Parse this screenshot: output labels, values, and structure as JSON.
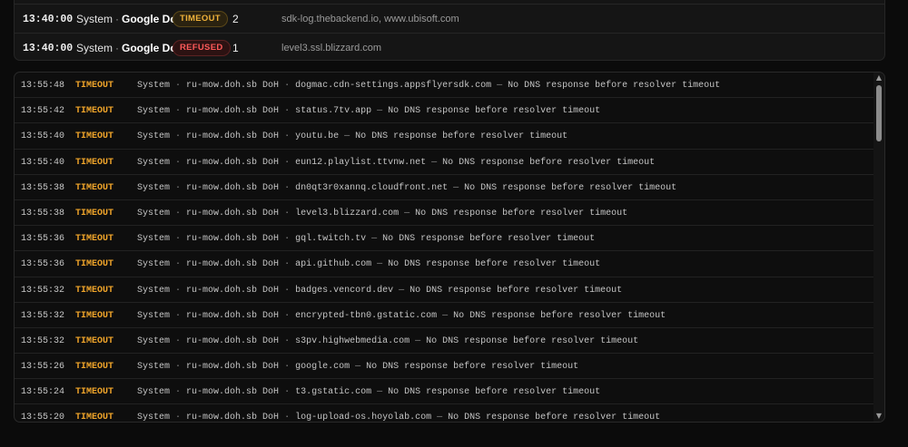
{
  "summary": {
    "rows": [
      {
        "time": "13:40:00",
        "system": "System",
        "resolver": "Google DoH",
        "status": "TIMEOUT",
        "count": "2",
        "domains": "sdk-log.thebackend.io, www.ubisoft.com"
      },
      {
        "time": "13:40:00",
        "system": "System",
        "resolver": "Google DoH",
        "status": "REFUSED",
        "count": "1",
        "domains": "level3.ssl.blizzard.com"
      }
    ]
  },
  "log": {
    "entries": [
      {
        "time": "13:55:48",
        "status": "TIMEOUT",
        "system": "System",
        "resolver": "ru-mow.doh.sb DoH",
        "domain": "dogmac.cdn-settings.appsflyersdk.com",
        "message": "No DNS response before resolver timeout"
      },
      {
        "time": "13:55:42",
        "status": "TIMEOUT",
        "system": "System",
        "resolver": "ru-mow.doh.sb DoH",
        "domain": "status.7tv.app",
        "message": "No DNS response before resolver timeout"
      },
      {
        "time": "13:55:40",
        "status": "TIMEOUT",
        "system": "System",
        "resolver": "ru-mow.doh.sb DoH",
        "domain": "youtu.be",
        "message": "No DNS response before resolver timeout"
      },
      {
        "time": "13:55:40",
        "status": "TIMEOUT",
        "system": "System",
        "resolver": "ru-mow.doh.sb DoH",
        "domain": "eun12.playlist.ttvnw.net",
        "message": "No DNS response before resolver timeout"
      },
      {
        "time": "13:55:38",
        "status": "TIMEOUT",
        "system": "System",
        "resolver": "ru-mow.doh.sb DoH",
        "domain": "dn0qt3r0xannq.cloudfront.net",
        "message": "No DNS response before resolver timeout"
      },
      {
        "time": "13:55:38",
        "status": "TIMEOUT",
        "system": "System",
        "resolver": "ru-mow.doh.sb DoH",
        "domain": "level3.blizzard.com",
        "message": "No DNS response before resolver timeout"
      },
      {
        "time": "13:55:36",
        "status": "TIMEOUT",
        "system": "System",
        "resolver": "ru-mow.doh.sb DoH",
        "domain": "gql.twitch.tv",
        "message": "No DNS response before resolver timeout"
      },
      {
        "time": "13:55:36",
        "status": "TIMEOUT",
        "system": "System",
        "resolver": "ru-mow.doh.sb DoH",
        "domain": "api.github.com",
        "message": "No DNS response before resolver timeout"
      },
      {
        "time": "13:55:32",
        "status": "TIMEOUT",
        "system": "System",
        "resolver": "ru-mow.doh.sb DoH",
        "domain": "badges.vencord.dev",
        "message": "No DNS response before resolver timeout"
      },
      {
        "time": "13:55:32",
        "status": "TIMEOUT",
        "system": "System",
        "resolver": "ru-mow.doh.sb DoH",
        "domain": "encrypted-tbn0.gstatic.com",
        "message": "No DNS response before resolver timeout"
      },
      {
        "time": "13:55:32",
        "status": "TIMEOUT",
        "system": "System",
        "resolver": "ru-mow.doh.sb DoH",
        "domain": "s3pv.highwebmedia.com",
        "message": "No DNS response before resolver timeout"
      },
      {
        "time": "13:55:26",
        "status": "TIMEOUT",
        "system": "System",
        "resolver": "ru-mow.doh.sb DoH",
        "domain": "google.com",
        "message": "No DNS response before resolver timeout"
      },
      {
        "time": "13:55:24",
        "status": "TIMEOUT",
        "system": "System",
        "resolver": "ru-mow.doh.sb DoH",
        "domain": "t3.gstatic.com",
        "message": "No DNS response before resolver timeout"
      },
      {
        "time": "13:55:20",
        "status": "TIMEOUT",
        "system": "System",
        "resolver": "ru-mow.doh.sb DoH",
        "domain": "log-upload-os.hoyolab.com",
        "message": "No DNS response before resolver timeout"
      }
    ]
  },
  "scrollbar": {
    "up_icon": "triangle-up-icon",
    "down_icon": "triangle-down-icon"
  },
  "colors": {
    "timeout": "#f0a52a",
    "refused": "#ff5a5a",
    "background": "#0b0b0b"
  }
}
